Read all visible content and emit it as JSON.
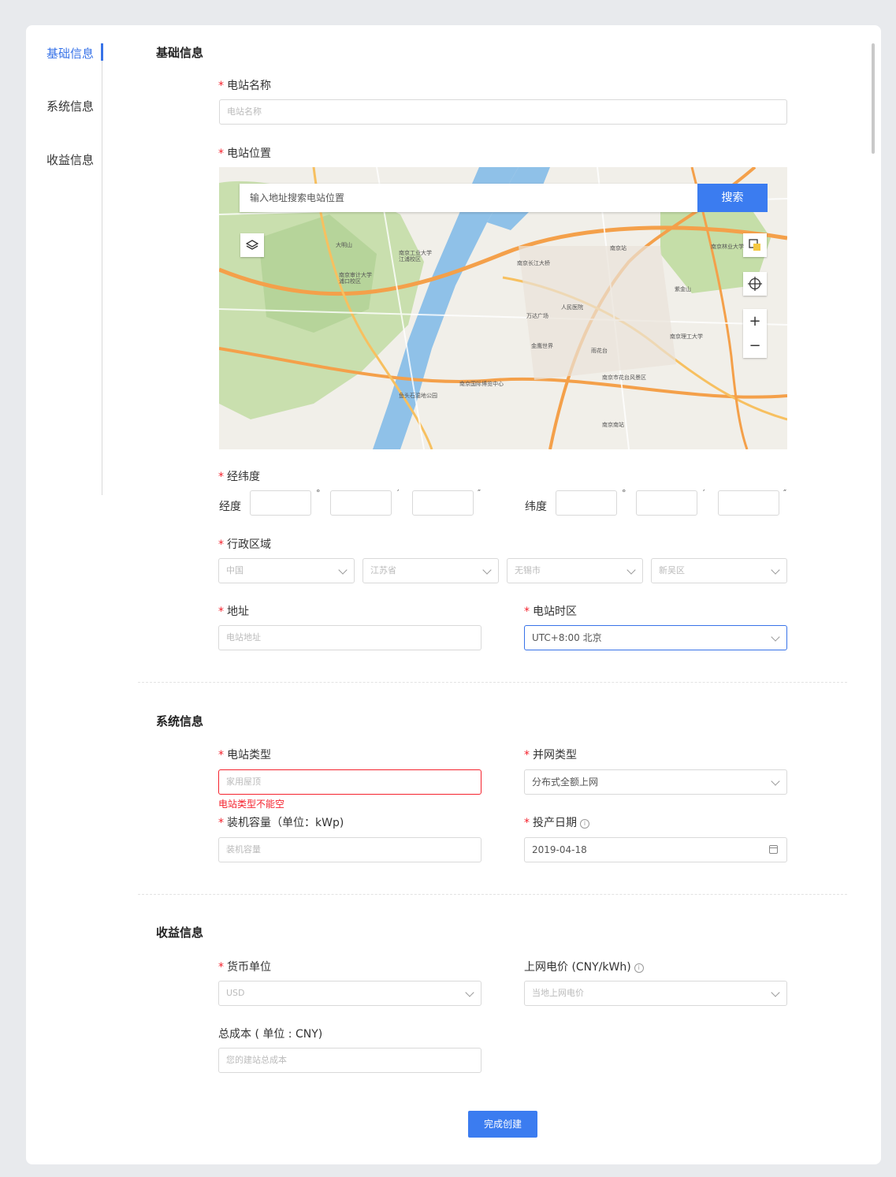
{
  "nav": {
    "items": [
      "基础信息",
      "系统信息",
      "收益信息"
    ],
    "active_index": 0
  },
  "sections": {
    "basic": "基础信息",
    "system": "系统信息",
    "income": "收益信息"
  },
  "basic": {
    "station_name_label": "电站名称",
    "station_name_placeholder": "电站名称",
    "location_label": "电站位置",
    "map": {
      "search_placeholder": "输入地址搜索电站位置",
      "search_button": "搜索",
      "zoom_in": "+",
      "zoom_out": "−",
      "place_labels": [
        "南京工业大学江浦校区",
        "南京审计大学浦口校区",
        "南京长江大桥",
        "南京林业大学",
        "南京站",
        "南京南站",
        "万达广场",
        "人民医院",
        "金鹰世界",
        "南京理工大学",
        "紫金山",
        "雨花台",
        "大明山",
        "南京国际博览中心",
        "南京市花台风景区",
        "鱼头石湿地公园"
      ]
    },
    "latlng_label": "经纬度",
    "longitude_label": "经度",
    "latitude_label": "纬度",
    "degree_mark": "°",
    "minute_mark": "′",
    "second_mark": "″",
    "region_label": "行政区域",
    "region_selects": [
      "中国",
      "江苏省",
      "无锡市",
      "新吴区"
    ],
    "address_label": "地址",
    "address_placeholder": "电站地址",
    "timezone_label": "电站时区",
    "timezone_value": "UTC+8:00 北京"
  },
  "system": {
    "station_type_label": "电站类型",
    "station_type_placeholder": "家用屋顶",
    "station_type_error": "电站类型不能空",
    "grid_type_label": "并网类型",
    "grid_type_value": "分布式全额上网",
    "capacity_label": "装机容量（单位：kWp)",
    "capacity_placeholder": "装机容量",
    "commission_date_label": "投产日期",
    "commission_date_value": "2019-04-18"
  },
  "income": {
    "currency_label": "货币单位",
    "currency_value": "USD",
    "price_label": "上网电价 (CNY/kWh)",
    "price_placeholder": "当地上网电价",
    "total_cost_label": "总成本 ( 单位 : CNY)",
    "total_cost_placeholder": "您的建站总成本"
  },
  "submit_label": "完成创建",
  "colors": {
    "accent": "#3b7cf0",
    "error": "#f5222d"
  }
}
